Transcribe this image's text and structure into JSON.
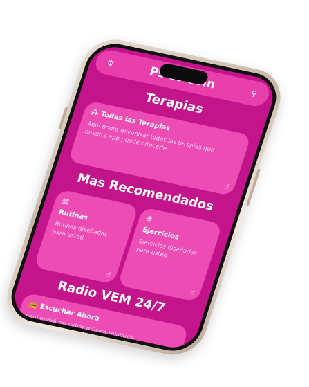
{
  "app": {
    "title": "Psicolovin",
    "settings_icon": "gear-icon",
    "search_icon": "search-icon"
  },
  "sections": {
    "therapies_title": "Terapias",
    "recommended_title": "Mas Recomendados",
    "radio_title": "Radio VEM 24/7"
  },
  "cards": {
    "all_therapies": {
      "label": "Todas las Terapias",
      "description": "Aqui podra encontrar todas las terapias que nuestra app puede ofrecerle",
      "icon": "network-icon"
    },
    "routines": {
      "label": "Rutinas",
      "description": "Rutinas diseñadas para usted",
      "icon": "map-icon"
    },
    "exercises": {
      "label": "Ejercicios",
      "description": "Ejercicios diseñados para usted",
      "icon": "lotus-icon"
    },
    "listen_now": {
      "label": "Escuchar Ahora",
      "description": "Aqui podrá escuchar música relajante",
      "icon": "radio-icon"
    }
  },
  "colors": {
    "screen_bg": "#c4148b",
    "card_bg": "#ec4cb4",
    "topbar_bg": "#e83fad"
  }
}
